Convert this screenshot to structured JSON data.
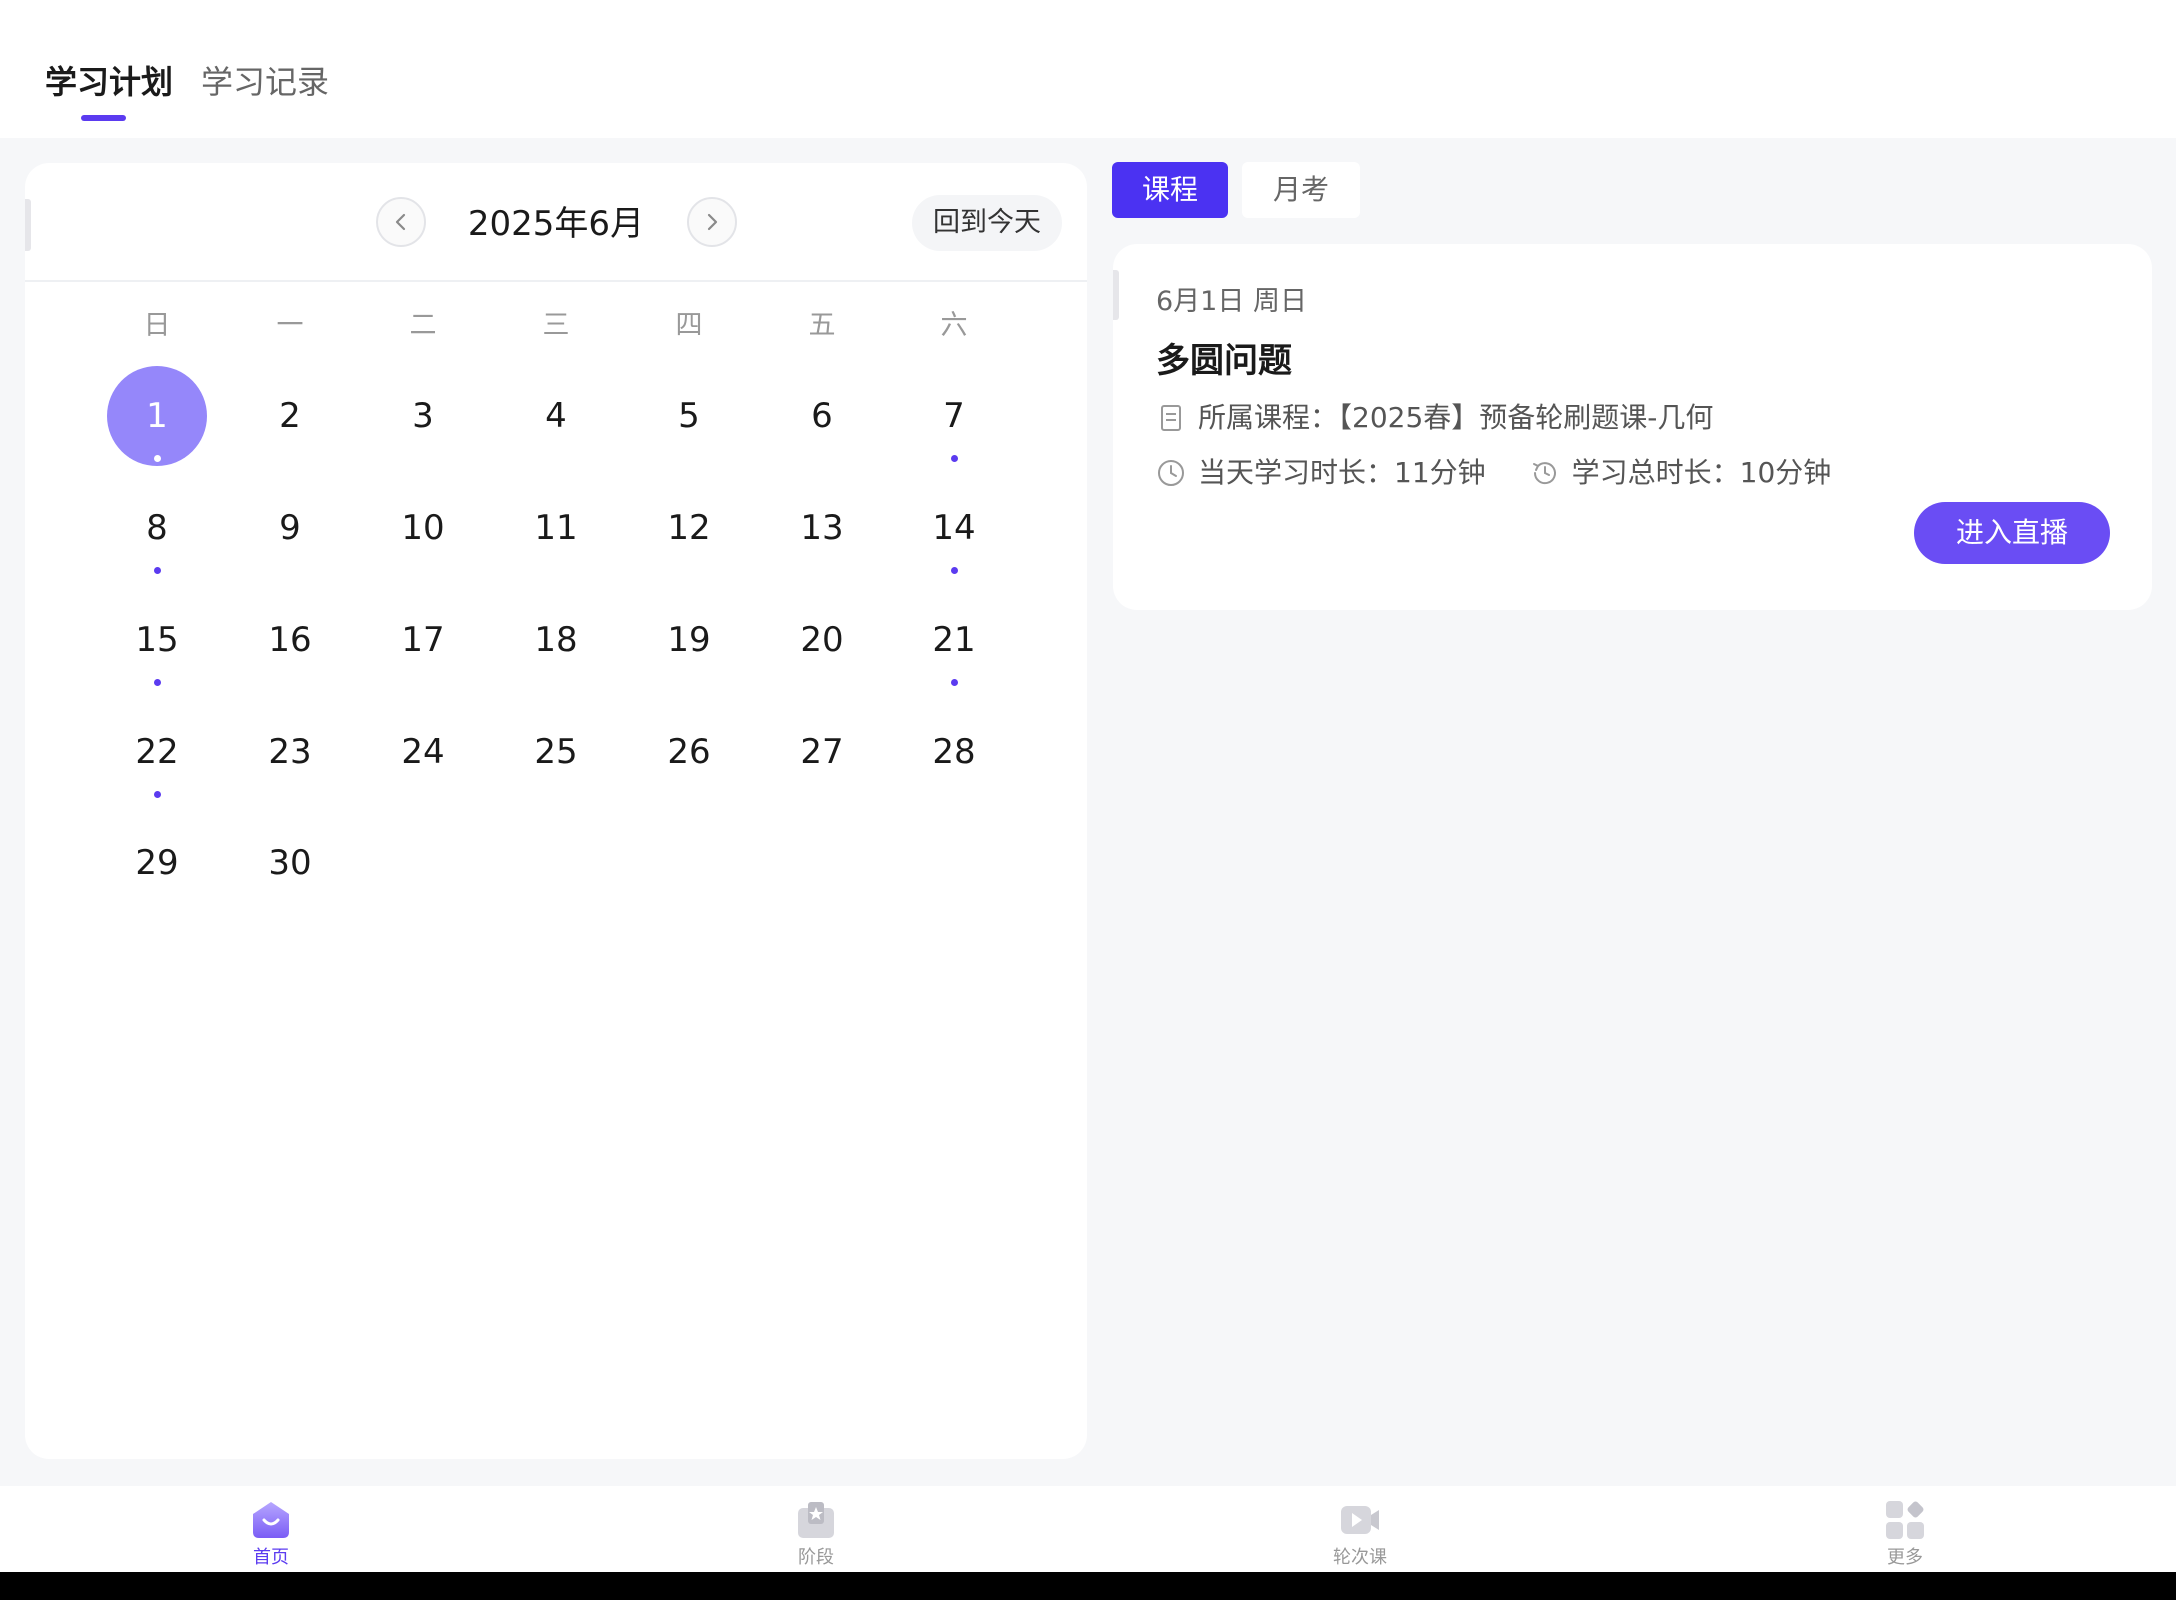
{
  "header": {
    "tabs": [
      {
        "label": "学习计划",
        "active": true
      },
      {
        "label": "学习记录",
        "active": false
      }
    ],
    "accent_color": "#5b3bf0"
  },
  "calendar": {
    "month_title": "2025年6月",
    "today_label": "回到今天",
    "prev_icon": "chevron-left-icon",
    "next_icon": "chevron-right-icon",
    "weekdays": [
      "日",
      "一",
      "二",
      "三",
      "四",
      "五",
      "六"
    ],
    "first_weekday_index": 0,
    "selected_day": 1,
    "days_with_dots": [
      1,
      7,
      8,
      14,
      15,
      21,
      22
    ],
    "days": [
      "1",
      "2",
      "3",
      "4",
      "5",
      "6",
      "7",
      "8",
      "9",
      "10",
      "11",
      "12",
      "13",
      "14",
      "15",
      "16",
      "17",
      "18",
      "19",
      "20",
      "21",
      "22",
      "23",
      "24",
      "25",
      "26",
      "27",
      "28",
      "29",
      "30"
    ],
    "selected_color": "#9587fa"
  },
  "panel": {
    "tabs": [
      {
        "label": "课程",
        "active": true
      },
      {
        "label": "月考",
        "active": false
      }
    ],
    "course": {
      "date": "6月1日 周日",
      "title": "多圆问题",
      "course_label": "所属课程：【2025春】预备轮刷题课-几何",
      "day_duration": "当天学习时长：11分钟",
      "total_duration": "学习总时长：10分钟",
      "live_button": "进入直播",
      "icons": [
        "document-icon",
        "clock-icon",
        "history-icon"
      ]
    }
  },
  "bottom_nav": {
    "items": [
      {
        "label": "首页",
        "icon": "home-icon",
        "active": true
      },
      {
        "label": "阶段",
        "icon": "stage-icon",
        "active": false
      },
      {
        "label": "轮次课",
        "icon": "video-icon",
        "active": false
      },
      {
        "label": "更多",
        "icon": "more-icon",
        "active": false
      }
    ]
  }
}
